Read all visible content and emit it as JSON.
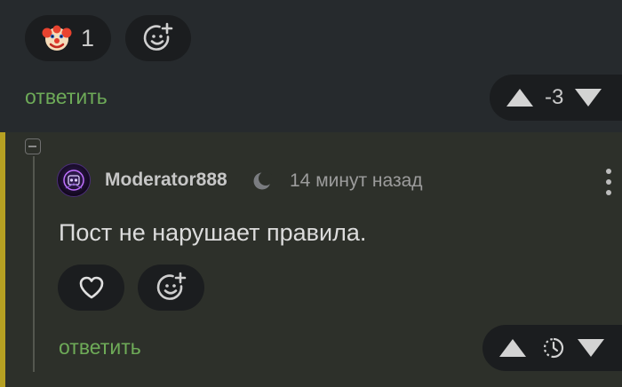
{
  "top_comment": {
    "reaction": {
      "emoji": "🤡",
      "count": "1"
    },
    "reply_label": "ответить",
    "score": "-3"
  },
  "reply_comment": {
    "author": "Moderator888",
    "time": "14 минут назад",
    "text": "Пост не нарушает правила.",
    "reply_label": "ответить"
  },
  "colors": {
    "accent": "#b6a022",
    "link": "#6eab58",
    "background": "#262a2d",
    "highlight_background": "#2d302a"
  }
}
